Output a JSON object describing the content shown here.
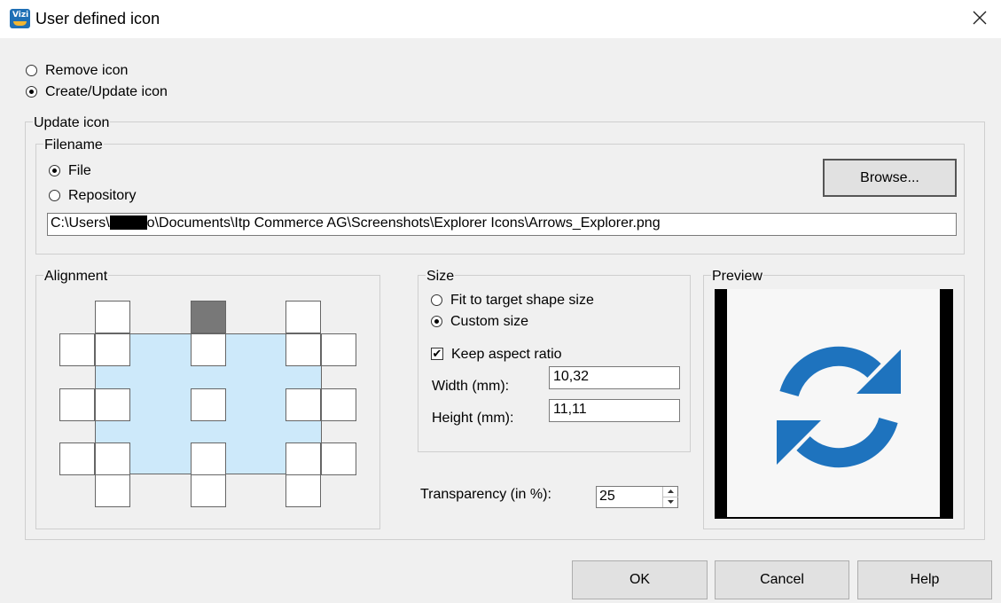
{
  "window": {
    "title": "User defined icon",
    "app_icon_text": "Vizi"
  },
  "mode": {
    "remove_label": "Remove icon",
    "create_label": "Create/Update icon",
    "selected": "create"
  },
  "update_group": {
    "legend": "Update icon",
    "filename": {
      "legend": "Filename",
      "file_label": "File",
      "repository_label": "Repository",
      "selected": "file",
      "browse_label": "Browse...",
      "path_prefix": "C:\\Users\\",
      "path_suffix": "o\\Documents\\Itp Commerce AG\\Screenshots\\Explorer Icons\\Arrows_Explorer.png"
    },
    "alignment": {
      "legend": "Alignment",
      "selected": "top-center-outside"
    },
    "size": {
      "legend": "Size",
      "fit_label": "Fit to target shape size",
      "custom_label": "Custom size",
      "selected": "custom",
      "keep_aspect_label": "Keep aspect ratio",
      "keep_aspect_checked": true,
      "checkmark": "✔",
      "width_label": "Width (mm):",
      "width_value": "10,32",
      "height_label": "Height (mm):",
      "height_value": "11,11"
    },
    "transparency": {
      "label": "Transparency (in %):",
      "value": "25"
    },
    "preview": {
      "legend": "Preview",
      "icon": "refresh-arrows-icon",
      "icon_color": "#1e73be"
    }
  },
  "footer": {
    "ok_label": "OK",
    "cancel_label": "Cancel",
    "help_label": "Help"
  },
  "colors": {
    "dialog_bg": "#f0f0f0",
    "shape_fill": "#cde9fa",
    "selected_anchor": "#787878"
  }
}
